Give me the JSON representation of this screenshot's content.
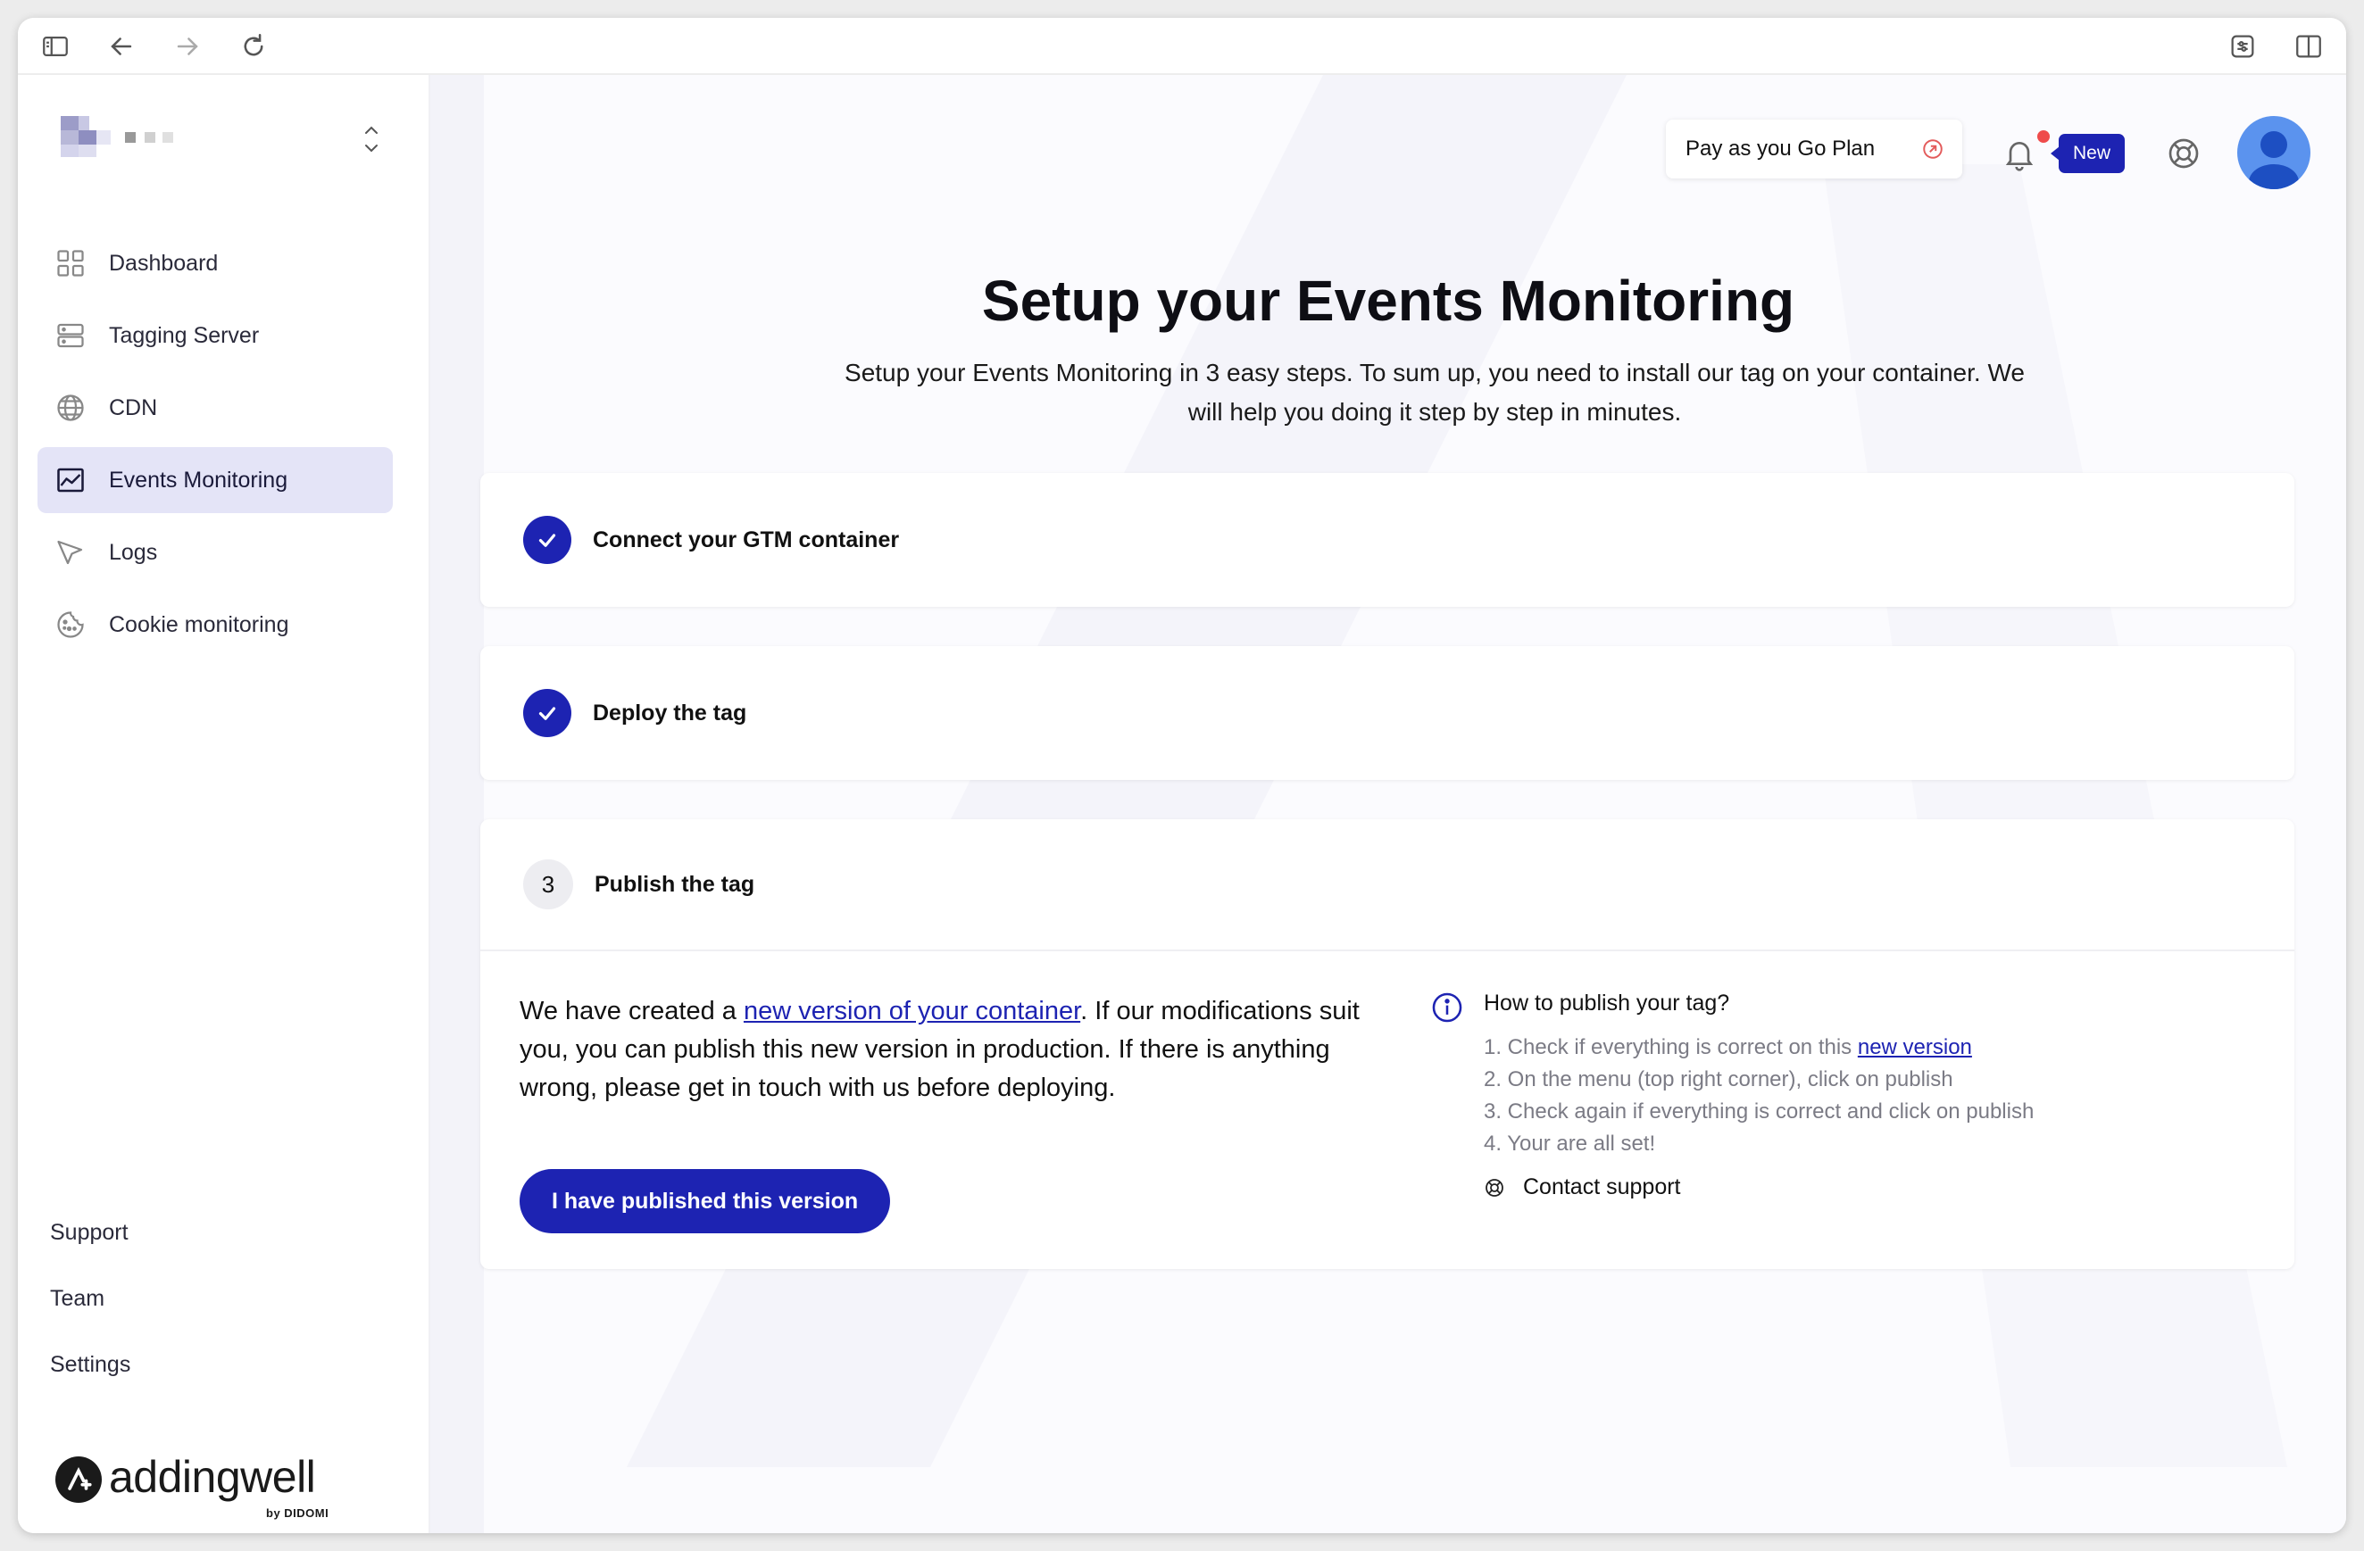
{
  "sidebar": {
    "items": [
      {
        "label": "Dashboard",
        "icon": "grid-icon",
        "active": false
      },
      {
        "label": "Tagging Server",
        "icon": "server-icon",
        "active": false
      },
      {
        "label": "CDN",
        "icon": "globe-icon",
        "active": false
      },
      {
        "label": "Events Monitoring",
        "icon": "chart-line-icon",
        "active": true
      },
      {
        "label": "Logs",
        "icon": "cursor-arrow-icon",
        "active": false
      },
      {
        "label": "Cookie monitoring",
        "icon": "cookie-icon",
        "active": false
      }
    ],
    "bottom_links": [
      "Support",
      "Team",
      "Settings"
    ],
    "brand": {
      "name": "addingwell",
      "sub": "by DIDOMI"
    }
  },
  "header": {
    "plan_label": "Pay as you Go Plan",
    "new_badge": "New"
  },
  "page": {
    "title": "Setup your Events Monitoring",
    "subtitle": "Setup your Events Monitoring in 3 easy steps. To sum up, you need to install our tag on your container. We will help you doing it step by step in minutes."
  },
  "steps": [
    {
      "title": "Connect your GTM container",
      "status": "done"
    },
    {
      "title": "Deploy the tag",
      "status": "done"
    },
    {
      "number": "3",
      "title": "Publish the tag",
      "status": "current"
    }
  ],
  "publish": {
    "text_before": "We have created a ",
    "link_text": "new version of your container",
    "text_after": ". If our modifications suit you, you can publish this new version in production. If there is anything wrong, please get in touch with us before deploying.",
    "button_label": "I have published this version",
    "howto_title": "How to publish your tag?",
    "howto_step1_before": "1. Check if everything is correct on this ",
    "howto_step1_link": "new version",
    "howto_step2": "2. On the menu (top right corner), click on publish",
    "howto_step3": "3. Check again if everything is correct and click on publish",
    "howto_step4": "4. Your are all set!",
    "contact_label": "Contact support"
  },
  "colors": {
    "accent": "#1d23b2",
    "active_nav_bg": "#e4e4f7",
    "notification_dot": "#ef4b4b",
    "avatar": "#5b93ee"
  }
}
